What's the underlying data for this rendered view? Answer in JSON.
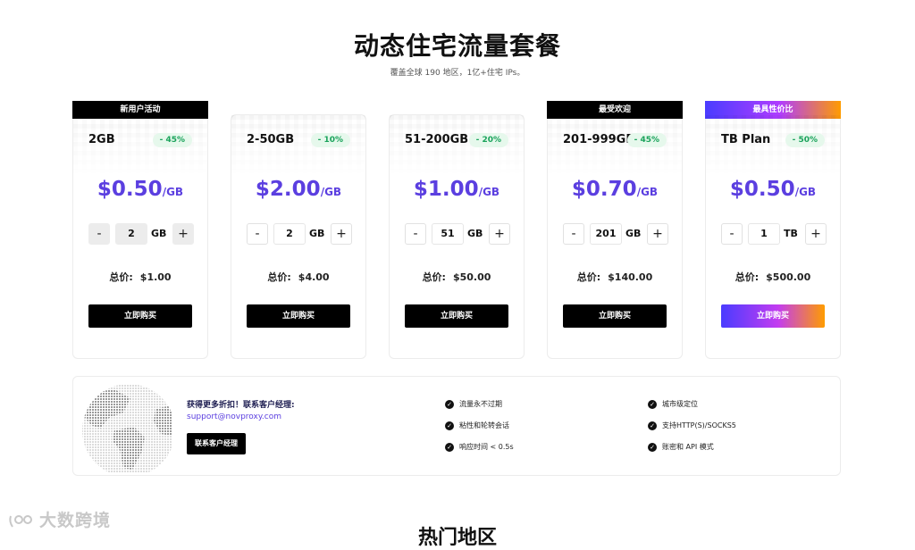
{
  "header": {
    "title": "动态住宅流量套餐",
    "subtitle": "覆盖全球 190 地区，1亿+住宅 IPs。"
  },
  "plans": [
    {
      "tag": "新用户活动",
      "name": "2GB",
      "discount": "- 45%",
      "price": "$0.50",
      "unit": "/GB",
      "quantity": "2",
      "qty_unit": "GB",
      "total_label": "总价:",
      "total": "$1.00",
      "buy_label": "立即购买"
    },
    {
      "tag": "",
      "name": "2-50GB",
      "discount": "- 10%",
      "price": "$2.00",
      "unit": "/GB",
      "quantity": "2",
      "qty_unit": "GB",
      "total_label": "总价:",
      "total": "$4.00",
      "buy_label": "立即购买"
    },
    {
      "tag": "",
      "name": "51-200GB",
      "discount": "- 20%",
      "price": "$1.00",
      "unit": "/GB",
      "quantity": "51",
      "qty_unit": "GB",
      "total_label": "总价:",
      "total": "$50.00",
      "buy_label": "立即购买"
    },
    {
      "tag": "最受欢迎",
      "name": "201-999GB",
      "discount": "- 45%",
      "price": "$0.70",
      "unit": "/GB",
      "quantity": "201",
      "qty_unit": "GB",
      "total_label": "总价:",
      "total": "$140.00",
      "buy_label": "立即购买"
    },
    {
      "tag": "最具性价比",
      "name": "TB Plan",
      "discount": "- 50%",
      "price": "$0.50",
      "unit": "/GB",
      "quantity": "1",
      "qty_unit": "TB",
      "total_label": "总价:",
      "total": "$500.00",
      "buy_label": "立即购买"
    }
  ],
  "stepper": {
    "minus": "-",
    "plus": "+"
  },
  "contact": {
    "text": "获得更多折扣！联系客户经理:",
    "email": "support@novproxy.com",
    "button": "联系客户经理"
  },
  "features": [
    "流量永不过期",
    "城市级定位",
    "粘性和轮转会话",
    "支持HTTP(S)/SOCKS5",
    "响应时间 < 0.5s",
    "账密和 API 模式"
  ],
  "watermark": "大数跨境",
  "next_section": {
    "title": "热门地区"
  },
  "colors": {
    "accent": "#5b3fe0",
    "discount_bg": "#e6f8ec",
    "discount_text": "#1aa35b",
    "gradient_start": "#4a3cff",
    "gradient_end": "#ff9c00"
  }
}
